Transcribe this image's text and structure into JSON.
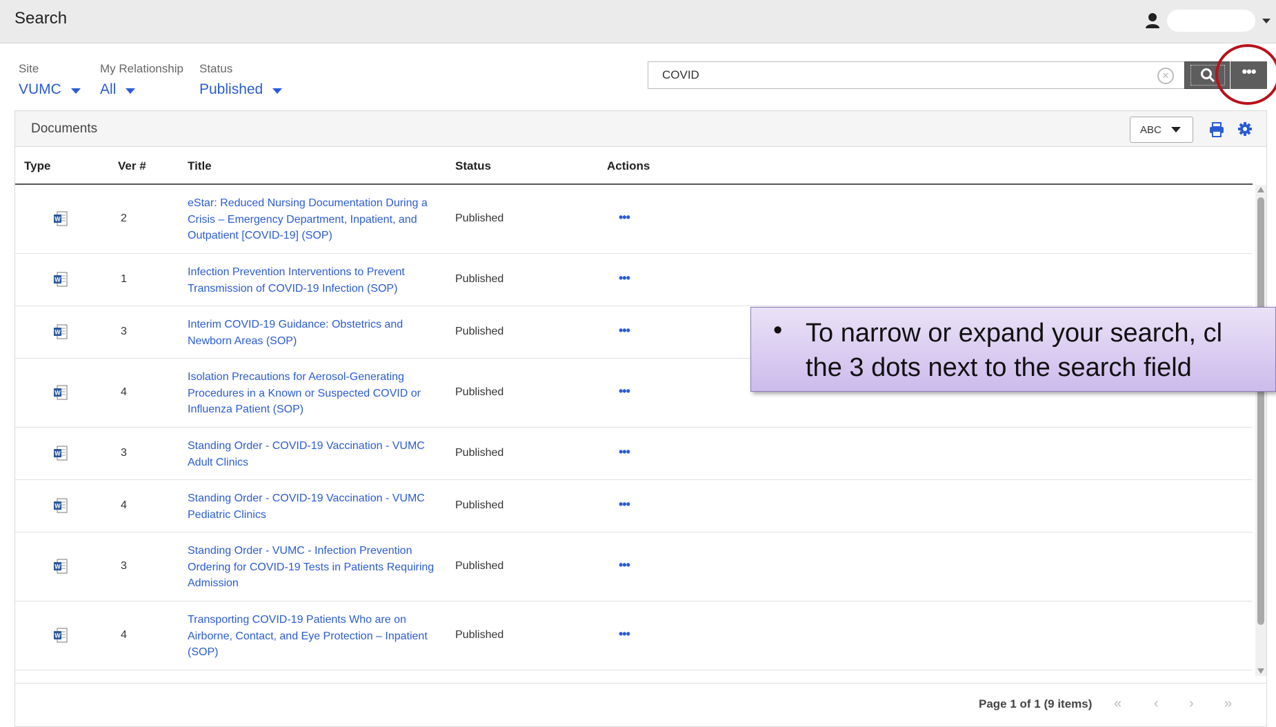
{
  "header": {
    "title": "Search"
  },
  "filters": {
    "site": {
      "label": "Site",
      "value": "VUMC"
    },
    "relationship": {
      "label": "My Relationship",
      "value": "All"
    },
    "status": {
      "label": "Status",
      "value": "Published"
    }
  },
  "search": {
    "value": "COVID"
  },
  "panel": {
    "title": "Documents",
    "sort_value": "ABC"
  },
  "columns": {
    "type": "Type",
    "ver": "Ver #",
    "title": "Title",
    "status": "Status",
    "actions": "Actions"
  },
  "rows": [
    {
      "ver": "2",
      "title": "eStar: Reduced Nursing Documentation During a Crisis – Emergency Department, Inpatient, and Outpatient [COVID-19] (SOP)",
      "status": "Published",
      "actions": "•••"
    },
    {
      "ver": "1",
      "title": "Infection Prevention Interventions to Prevent Transmission of COVID-19 Infection (SOP)",
      "status": "Published",
      "actions": "•••"
    },
    {
      "ver": "3",
      "title": "Interim COVID-19 Guidance: Obstetrics and Newborn Areas (SOP)",
      "status": "Published",
      "actions": "•••"
    },
    {
      "ver": "4",
      "title": "Isolation Precautions for Aerosol-Generating Procedures in a Known or Suspected COVID or Influenza Patient (SOP)",
      "status": "Published",
      "actions": "•••"
    },
    {
      "ver": "3",
      "title": "Standing Order - COVID-19 Vaccination - VUMC Adult Clinics",
      "status": "Published",
      "actions": "•••"
    },
    {
      "ver": "4",
      "title": "Standing Order - COVID-19 Vaccination - VUMC Pediatric Clinics",
      "status": "Published",
      "actions": "•••"
    },
    {
      "ver": "3",
      "title": "Standing Order - VUMC - Infection Prevention Ordering for COVID-19 Tests in Patients Requiring Admission",
      "status": "Published",
      "actions": "•••"
    },
    {
      "ver": "4",
      "title": "Transporting COVID-19 Patients Who are on Airborne, Contact, and Eye Protection – Inpatient (SOP)",
      "status": "Published",
      "actions": "•••"
    }
  ],
  "pagination": {
    "info": "Page 1 of 1 (9 items)",
    "first": "«",
    "prev": "‹",
    "next": "›",
    "last": "»"
  },
  "callout": {
    "bullet": "•",
    "line1": "To narrow or expand your search, cl",
    "line2": "the 3 dots next to the search field"
  },
  "icons": {
    "doc_type": "word-document-icon",
    "print": "print-icon",
    "settings": "gear-icon",
    "user": "user-icon",
    "search": "search-icon",
    "more": "more-options-icon",
    "clear": "clear-icon"
  },
  "colors": {
    "link": "#2a5bd7",
    "highlight": "#b8121b",
    "callout_bg": "#d9ccf0"
  }
}
